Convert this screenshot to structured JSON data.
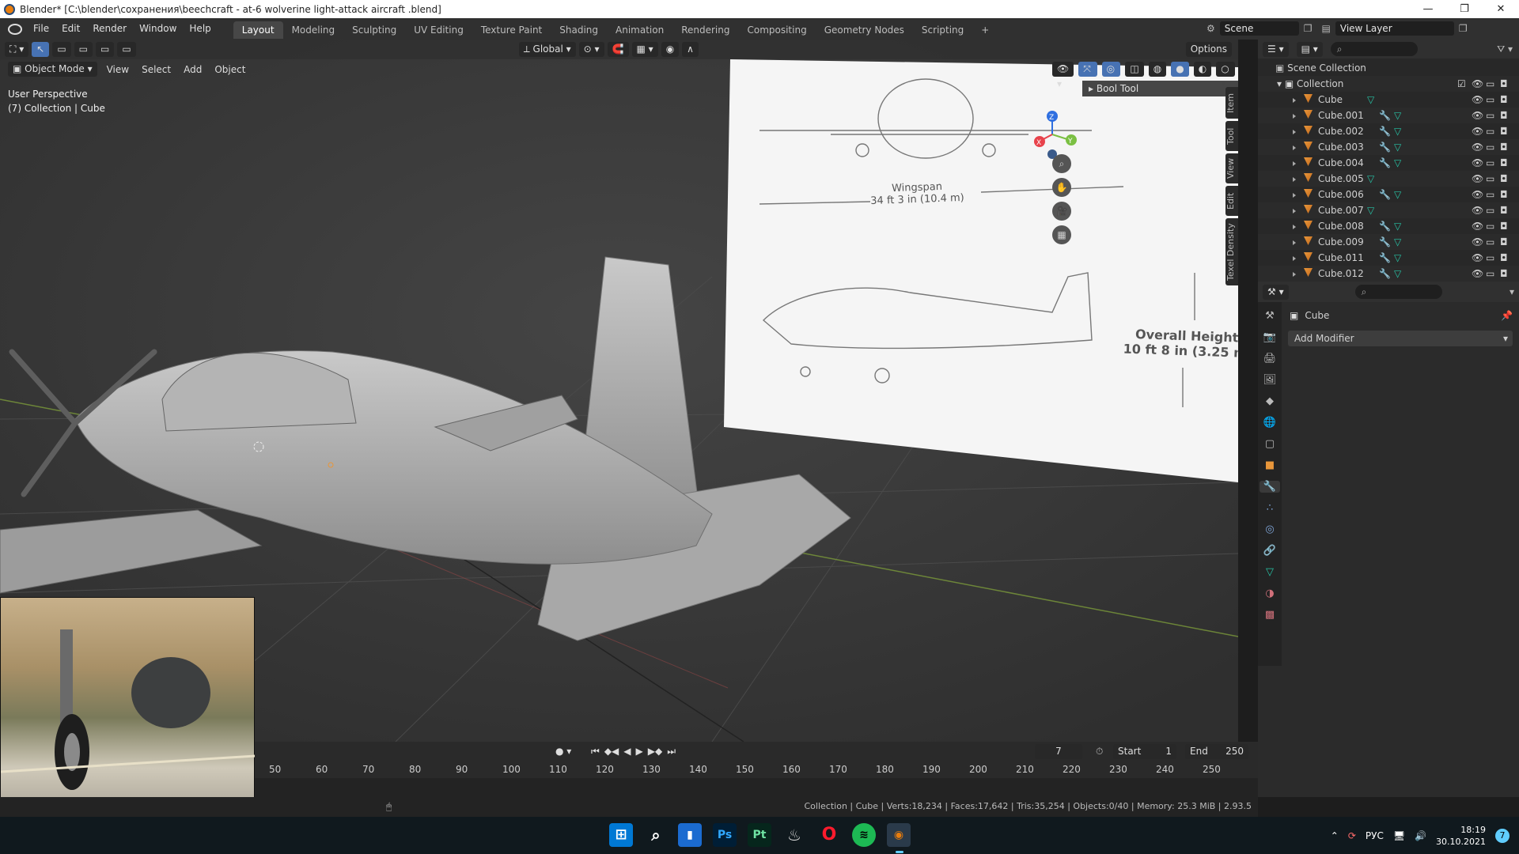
{
  "window": {
    "title": "Blender* [C:\\blender\\сохранения\\beechcraft - at-6 wolverine light-attack aircraft .blend]",
    "controls": [
      "—",
      "❐",
      "✕"
    ]
  },
  "menu": {
    "items": [
      "File",
      "Edit",
      "Render",
      "Window",
      "Help"
    ],
    "workspaces": [
      "Layout",
      "Modeling",
      "Sculpting",
      "UV Editing",
      "Texture Paint",
      "Shading",
      "Animation",
      "Rendering",
      "Compositing",
      "Geometry Nodes",
      "Scripting",
      "+"
    ],
    "active_workspace": "Layout",
    "scene": "Scene",
    "view_layer": "View Layer"
  },
  "viewport": {
    "orientation": "Global",
    "options_label": "Options",
    "mode": "Object Mode",
    "menus": [
      "View",
      "Select",
      "Add",
      "Object"
    ],
    "perspective_label": "User Perspective",
    "collection_label": "(7) Collection | Cube",
    "bool_tool_label": "Bool Tool",
    "side_tabs": [
      "Item",
      "Tool",
      "View",
      "Edit",
      "Texel Density"
    ],
    "gizmo_axes": {
      "x": "X",
      "y": "Y",
      "z": "Z"
    },
    "reference_image": {
      "wingspan_title": "Wingspan",
      "wingspan_value": "34 ft 3 in (10.4 m)",
      "height_title": "Overall Height",
      "height_value": "10 ft 8 in (3.25 m"
    }
  },
  "outliner": {
    "root": "Scene Collection",
    "collection": "Collection",
    "objects": [
      {
        "name": "Cube",
        "modifier": false
      },
      {
        "name": "Cube.001",
        "modifier": true
      },
      {
        "name": "Cube.002",
        "modifier": true
      },
      {
        "name": "Cube.003",
        "modifier": true
      },
      {
        "name": "Cube.004",
        "modifier": true
      },
      {
        "name": "Cube.005",
        "modifier": false
      },
      {
        "name": "Cube.006",
        "modifier": true
      },
      {
        "name": "Cube.007",
        "modifier": false
      },
      {
        "name": "Cube.008",
        "modifier": true
      },
      {
        "name": "Cube.009",
        "modifier": true
      },
      {
        "name": "Cube.011",
        "modifier": true
      },
      {
        "name": "Cube.012",
        "modifier": true
      }
    ]
  },
  "properties": {
    "object_name": "Cube",
    "add_modifier_label": "Add Modifier"
  },
  "timeline": {
    "current_frame": "7",
    "start_label": "Start",
    "start_value": "1",
    "end_label": "End",
    "end_value": "250",
    "ruler": [
      "50",
      "60",
      "70",
      "80",
      "90",
      "100",
      "110",
      "120",
      "130",
      "140",
      "150",
      "160",
      "170",
      "180",
      "190",
      "200",
      "210",
      "220",
      "230",
      "240",
      "250"
    ]
  },
  "status": {
    "text": "Collection | Cube | Verts:18,234 | Faces:17,642 | Tris:35,254 | Objects:0/40 | Memory: 25.3 MiB | 2.93.5"
  },
  "taskbar": {
    "apps": [
      "Ps",
      "Pt"
    ],
    "lang": "РУС",
    "time": "18:19",
    "date": "30.10.2021",
    "notif": "7"
  },
  "colors": {
    "accent": "#4772b3",
    "orange": "#e87d0d",
    "viewport_bg": "#3d3d3d"
  }
}
